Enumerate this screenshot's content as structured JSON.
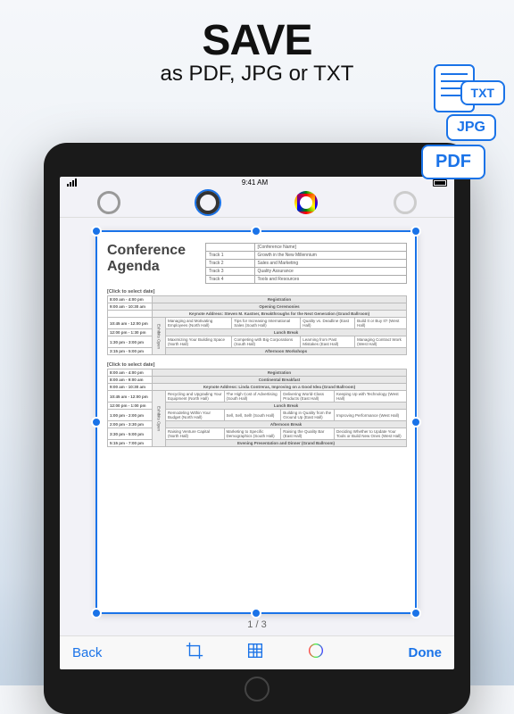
{
  "marketing": {
    "headline": "SAVE",
    "subhead": "as PDF, JPG or TXT",
    "badges": {
      "pdf": "PDF",
      "jpg": "JPG",
      "txt": "TXT"
    }
  },
  "statusbar": {
    "time": "9:41 AM",
    "wifi": "wifi",
    "battery": "100%"
  },
  "editor": {
    "page_indicator": "1 / 3",
    "back": "Back",
    "done": "Done"
  },
  "document": {
    "title": "Conference Agenda",
    "header_tracks": [
      [
        "",
        "[Conference Name]"
      ],
      [
        "Track 1",
        "Growth in the New Millennium"
      ],
      [
        "Track 2",
        "Sales and Marketing"
      ],
      [
        "Track 3",
        "Quality Assurance"
      ],
      [
        "Track 4",
        "Tools and Resources"
      ]
    ],
    "days": [
      {
        "date": "[Click to select date]",
        "rows": [
          {
            "time": "8:00 am - 4:00 pm",
            "span": "Registration",
            "cls": "hdr"
          },
          {
            "time": "9:00 am - 10:30 am",
            "span": "Opening Ceremonies",
            "cls": "hdr"
          },
          {
            "time": "",
            "span": "Keynote Address: Steven M. Kastner, Breakthroughs for the Next Generation (Grand Ballroom)",
            "cls": "keynote"
          },
          {
            "time": "10:45 am - 12:00 pm",
            "cells": [
              "Managing and Motivating Employees (North Hall)",
              "Tips for Increasing International Sales (South Hall)",
              "Quality vs. Deadline (East Hall)",
              "Build It or Buy It? (West Hall)"
            ]
          },
          {
            "time": "12:00 pm - 1:30 pm",
            "span": "Lunch Break",
            "cls": "hdr"
          },
          {
            "time": "1:30 pm - 3:00 pm",
            "cells": [
              "Maximizing Your Building Space (North Hall)",
              "Competing with Big Corporations (South Hall)",
              "Learning from Past Mistakes (East Hall)",
              "Managing Contract Work (West Hall)"
            ]
          },
          {
            "time": "3:15 pm - 5:00 pm",
            "span": "Afternoon Workshops",
            "cls": "hdr"
          }
        ]
      },
      {
        "date": "[Click to select date]",
        "rows": [
          {
            "time": "8:00 am - 4:00 pm",
            "span": "Registration",
            "cls": "hdr"
          },
          {
            "time": "8:00 am - 9:00 am",
            "span": "Continental Breakfast",
            "cls": "hdr"
          },
          {
            "time": "9:00 am - 10:30 am",
            "span": "Keynote Address: Linda Contreras, Improving on a Good Idea (Grand Ballroom)",
            "cls": "keynote"
          },
          {
            "time": "10:45 am - 12:00 pm",
            "cells": [
              "Recycling and Upgrading Your Equipment (North Hall)",
              "The High Cost of Advertising (South Hall)",
              "Delivering World-Class Products (East Hall)",
              "Keeping Up with Technology (West Hall)"
            ]
          },
          {
            "time": "12:00 pm - 1:00 pm",
            "span": "Lunch Break",
            "cls": "hdr"
          },
          {
            "time": "1:00 pm - 2:00 pm",
            "cells": [
              "Remodeling Within Your Budget (North Hall)",
              "Sell, Sell, Sell! (South Hall)",
              "Building in Quality from the Ground Up (East Hall)",
              "Improving Performance (West Hall)"
            ]
          },
          {
            "time": "2:00 pm - 3:30 pm",
            "span": "Afternoon Break",
            "cls": "hdr"
          },
          {
            "time": "3:30 pm - 5:00 pm",
            "cells": [
              "Raising Venture Capital (North Hall)",
              "Marketing to Specific Demographics (South Hall)",
              "Raising the Quality Bar (East Hall)",
              "Deciding Whether to Update Your Tools or Build New Ones (West Hall)"
            ]
          },
          {
            "time": "5:15 pm - 7:00 pm",
            "span": "Evening Presentation and Dinner (Grand Ballroom)",
            "cls": "hdr"
          }
        ]
      }
    ]
  }
}
